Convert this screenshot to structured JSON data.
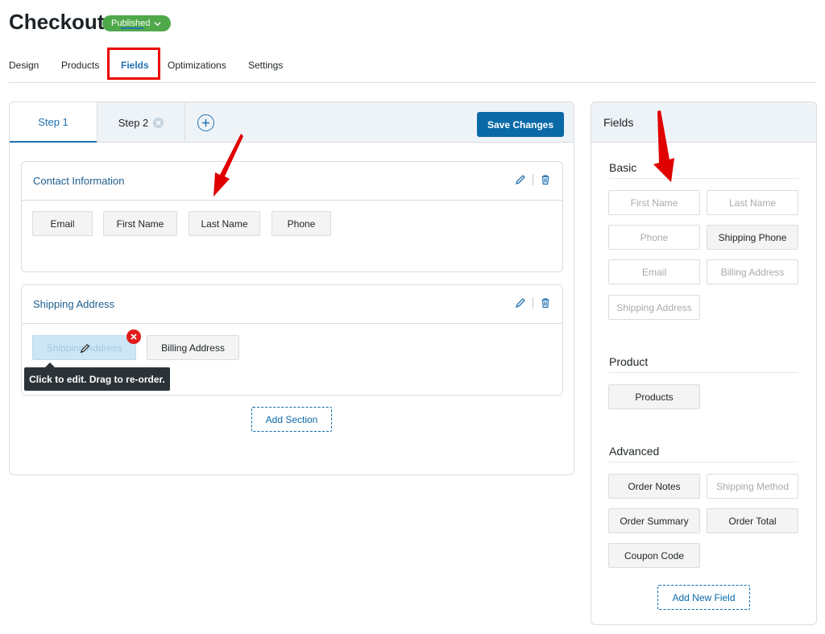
{
  "header": {
    "title": "Checkout",
    "status": "Published"
  },
  "main_tabs": [
    "Design",
    "Products",
    "Fields",
    "Optimizations",
    "Settings"
  ],
  "active_tab": "Fields",
  "steps": {
    "step1": "Step 1",
    "step2": "Step 2",
    "save": "Save Changes"
  },
  "sections": [
    {
      "title": "Contact Information",
      "fields": [
        "Email",
        "First Name",
        "Last Name",
        "Phone"
      ]
    },
    {
      "title": "Shipping Address",
      "fields": [
        "Shipping Address",
        "Billing Address"
      ]
    }
  ],
  "tooltip": "Click to edit. Drag to re-order.",
  "add_section": "Add Section",
  "panel": {
    "title": "Fields",
    "basic": {
      "title": "Basic",
      "fields": [
        "First Name",
        "Last Name",
        "Phone",
        "Shipping Phone",
        "Email",
        "Billing Address",
        "Shipping Address"
      ]
    },
    "product": {
      "title": "Product",
      "fields": [
        "Products"
      ]
    },
    "advanced": {
      "title": "Advanced",
      "fields": [
        "Order Notes",
        "Shipping Method",
        "Order Summary",
        "Order Total",
        "Coupon Code"
      ]
    },
    "add_new": "Add New Field"
  },
  "colors": {
    "accent": "#2271b1",
    "primary_button": "#0a6aa8",
    "published": "#4fa94a",
    "annotation": "#e00000"
  }
}
